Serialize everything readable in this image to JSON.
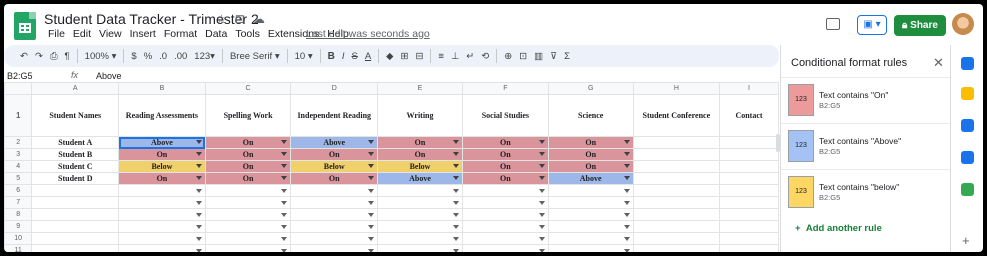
{
  "app": {
    "title": "Student Data Tracker - Trimester 2",
    "last_edit": "Last edit was seconds ago",
    "share_label": "Share"
  },
  "icons": {
    "logo": "sheets-logo-icon",
    "star": "star-icon",
    "move": "folder-move-icon",
    "cloud": "cloud-status-icon",
    "comment": "comment-icon",
    "present": "present-icon",
    "close": "close-icon",
    "add": "plus-icon"
  },
  "title_glyphs": {
    "star": "☆",
    "move": "⊡",
    "cloud": "☁"
  },
  "menu": [
    "File",
    "Edit",
    "View",
    "Insert",
    "Format",
    "Data",
    "Tools",
    "Extensions",
    "Help"
  ],
  "toolbar": {
    "undo": "↶",
    "redo": "↷",
    "print": "⎙",
    "paint": "¶",
    "zoom": "100%",
    "currency": "$",
    "percent": "%",
    "dec_less": ".0",
    "dec_more": ".00",
    "number_format": "123",
    "font": "Bree Serif",
    "font_size": "10",
    "bold": "B",
    "italic": "I",
    "strike": "S",
    "underline": "A",
    "fill": "◆",
    "borders": "⊞",
    "merge": "⊟",
    "align": "≡",
    "valign": "⊥",
    "wrap": "↵",
    "rotate": "⟲",
    "link": "⊕",
    "comment": "⊡",
    "chart": "▥",
    "filter": "⊽",
    "functions": "Σ"
  },
  "formula_bar": {
    "name_box": "B2:G5",
    "fx": "fx",
    "value": "Above"
  },
  "columns": [
    "A",
    "B",
    "C",
    "D",
    "E",
    "F",
    "G",
    "H",
    "I"
  ],
  "headers": [
    "Student Names",
    "Reading Assessments",
    "Spelling Work",
    "Independent Reading",
    "Writing",
    "Social Studies",
    "Science",
    "Student Conference",
    "Contact"
  ],
  "row_numbers": [
    "1",
    "2",
    "3",
    "4",
    "5",
    "6",
    "7",
    "8",
    "9",
    "10",
    "11"
  ],
  "students": [
    {
      "name": "Student A",
      "values": [
        "Above",
        "On",
        "Above",
        "On",
        "On",
        "On"
      ]
    },
    {
      "name": "Student B",
      "values": [
        "On",
        "On",
        "On",
        "On",
        "On",
        "On"
      ]
    },
    {
      "name": "Student C",
      "values": [
        "Below",
        "On",
        "Below",
        "Below",
        "On",
        "On"
      ]
    },
    {
      "name": "Student D",
      "values": [
        "On",
        "On",
        "On",
        "Above",
        "On",
        "Above"
      ]
    }
  ],
  "colors": {
    "on": "#d9959b",
    "above": "#9db7e8",
    "below": "#f0d06a",
    "brand_green": "#1e8e3e",
    "accent_blue": "#1a73e8"
  },
  "panel": {
    "title": "Conditional format rules",
    "rules": [
      {
        "swatch_text": "123",
        "condition": "Text contains \"On\"",
        "range": "B2:G5",
        "color": "#ec9a9a"
      },
      {
        "swatch_text": "123",
        "condition": "Text contains \"Above\"",
        "range": "B2:G5",
        "color": "#a4c2f4"
      },
      {
        "swatch_text": "123",
        "condition": "Text contains \"below\"",
        "range": "B2:G5",
        "color": "#fdd663"
      }
    ],
    "add_rule": "Add another rule"
  },
  "rail_icons": [
    {
      "name": "calendar-icon",
      "color": "#1a73e8"
    },
    {
      "name": "keep-icon",
      "color": "#fbbc04"
    },
    {
      "name": "tasks-icon",
      "color": "#1a73e8"
    },
    {
      "name": "contacts-icon",
      "color": "#1a73e8"
    },
    {
      "name": "maps-icon",
      "color": "#34a853"
    }
  ],
  "rail_add": "+"
}
